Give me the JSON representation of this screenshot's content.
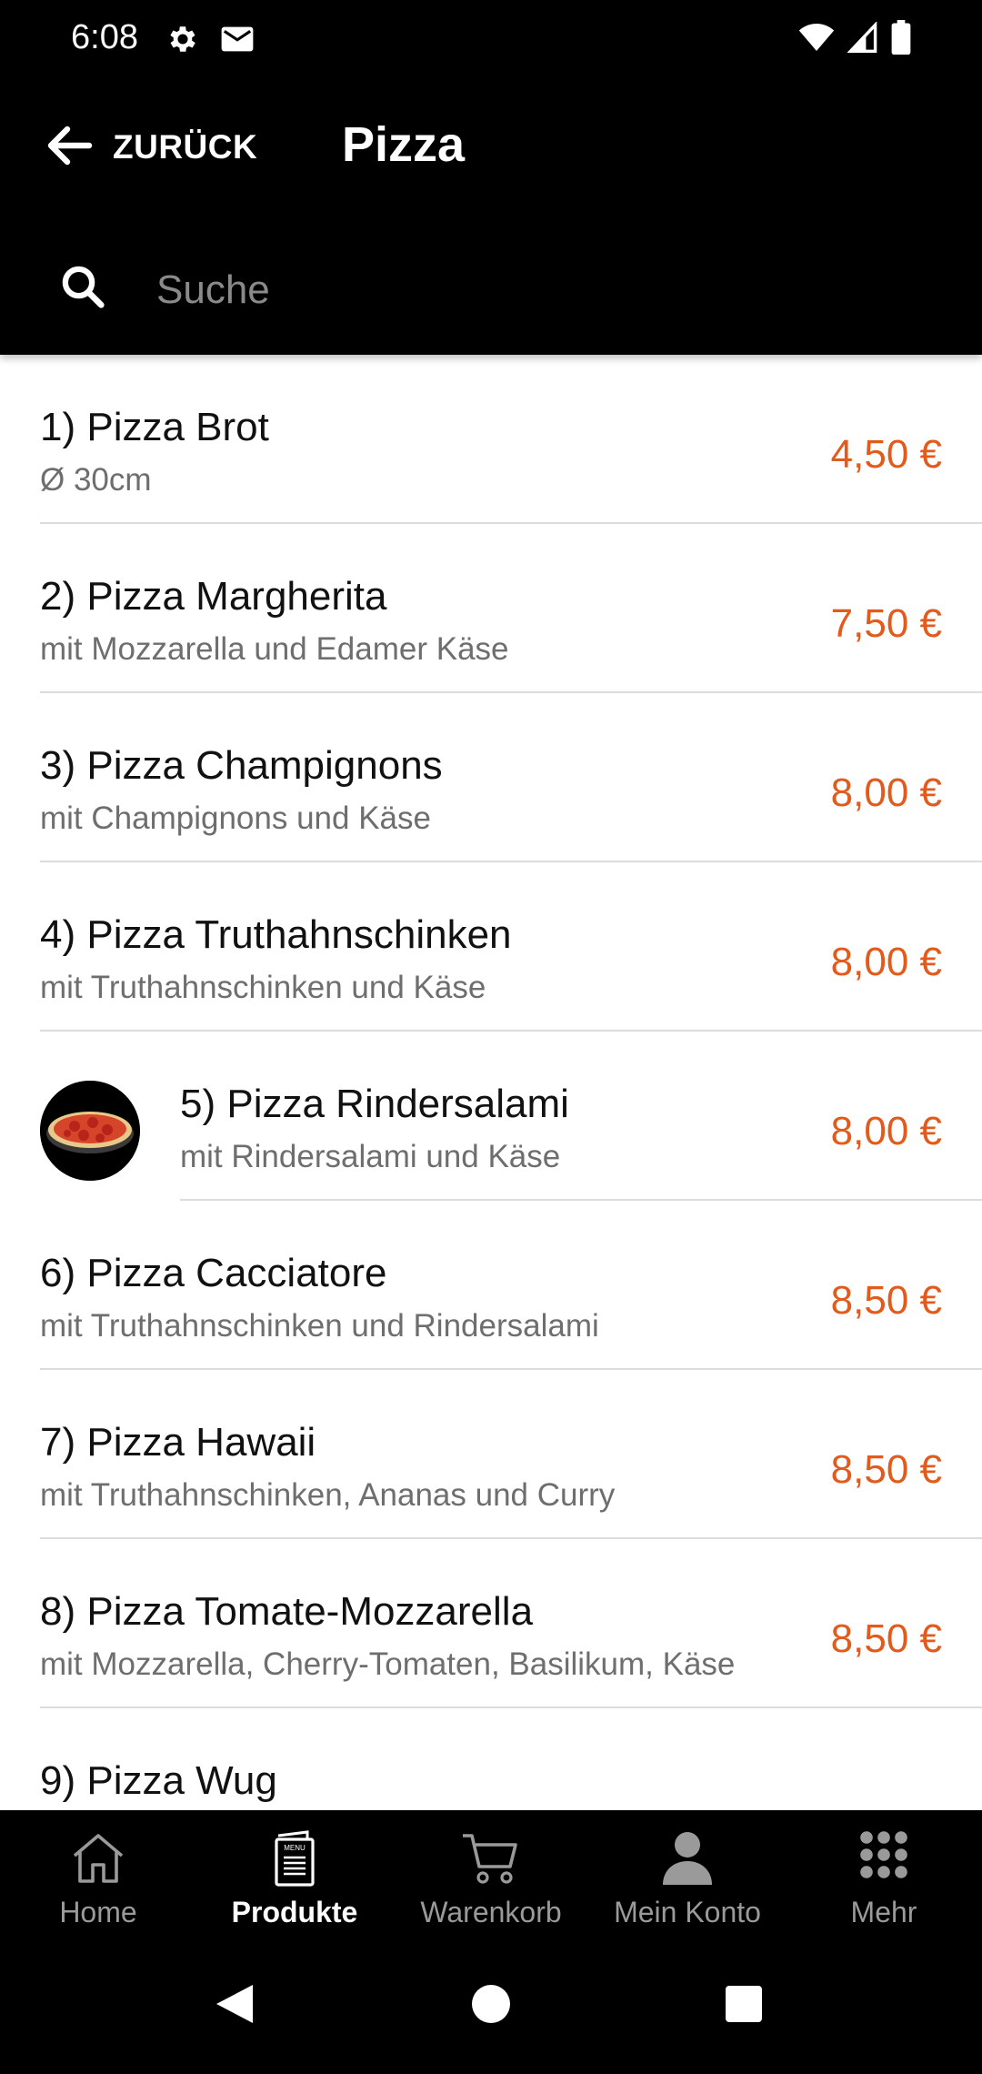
{
  "status_bar": {
    "time": "6:08",
    "icons_left": [
      "gear-icon",
      "mail-icon"
    ],
    "icons_right": [
      "wifi-icon",
      "signal-icon",
      "battery-icon"
    ]
  },
  "header": {
    "back_label": "ZURÜCK",
    "title": "Pizza"
  },
  "search": {
    "placeholder": "Suche",
    "value": ""
  },
  "items": [
    {
      "title": "1) Pizza Brot",
      "description": "Ø 30cm",
      "price": "4,50 €"
    },
    {
      "title": "2) Pizza Margherita",
      "description": "mit Mozzarella und Edamer Käse",
      "price": "7,50 €"
    },
    {
      "title": "3) Pizza Champignons",
      "description": "mit Champignons und Käse",
      "price": "8,00 €"
    },
    {
      "title": "4) Pizza Truthahnschinken",
      "description": "mit Truthahnschinken und Käse",
      "price": "8,00 €"
    },
    {
      "title": "5) Pizza Rindersalami",
      "description": "mit Rindersalami und Käse",
      "price": "8,00 €",
      "has_image": true
    },
    {
      "title": "6) Pizza Cacciatore",
      "description": "mit Truthahnschinken und Rindersalami",
      "price": "8,50 €"
    },
    {
      "title": "7) Pizza Hawaii",
      "description": "mit Truthahnschinken, Ananas und Curry",
      "price": "8,50 €"
    },
    {
      "title": "8) Pizza Tomate-Mozzarella",
      "description": "mit Mozzarella, Cherry-Tomaten, Basilikum, Käse",
      "price": "8,50 €"
    },
    {
      "title": "9) Pizza Wug",
      "description": "",
      "price": ""
    }
  ],
  "bottom_nav": [
    {
      "label": "Home",
      "icon": "home-icon",
      "active": false
    },
    {
      "label": "Produkte",
      "icon": "menu-card-icon",
      "active": true
    },
    {
      "label": "Warenkorb",
      "icon": "cart-icon",
      "active": false
    },
    {
      "label": "Mein Konto",
      "icon": "account-icon",
      "active": false
    },
    {
      "label": "Mehr",
      "icon": "grid-icon",
      "active": false
    }
  ],
  "colors": {
    "price": "#e25a1c",
    "background_dark": "#000000",
    "nav_inactive": "#9a9a9a"
  }
}
